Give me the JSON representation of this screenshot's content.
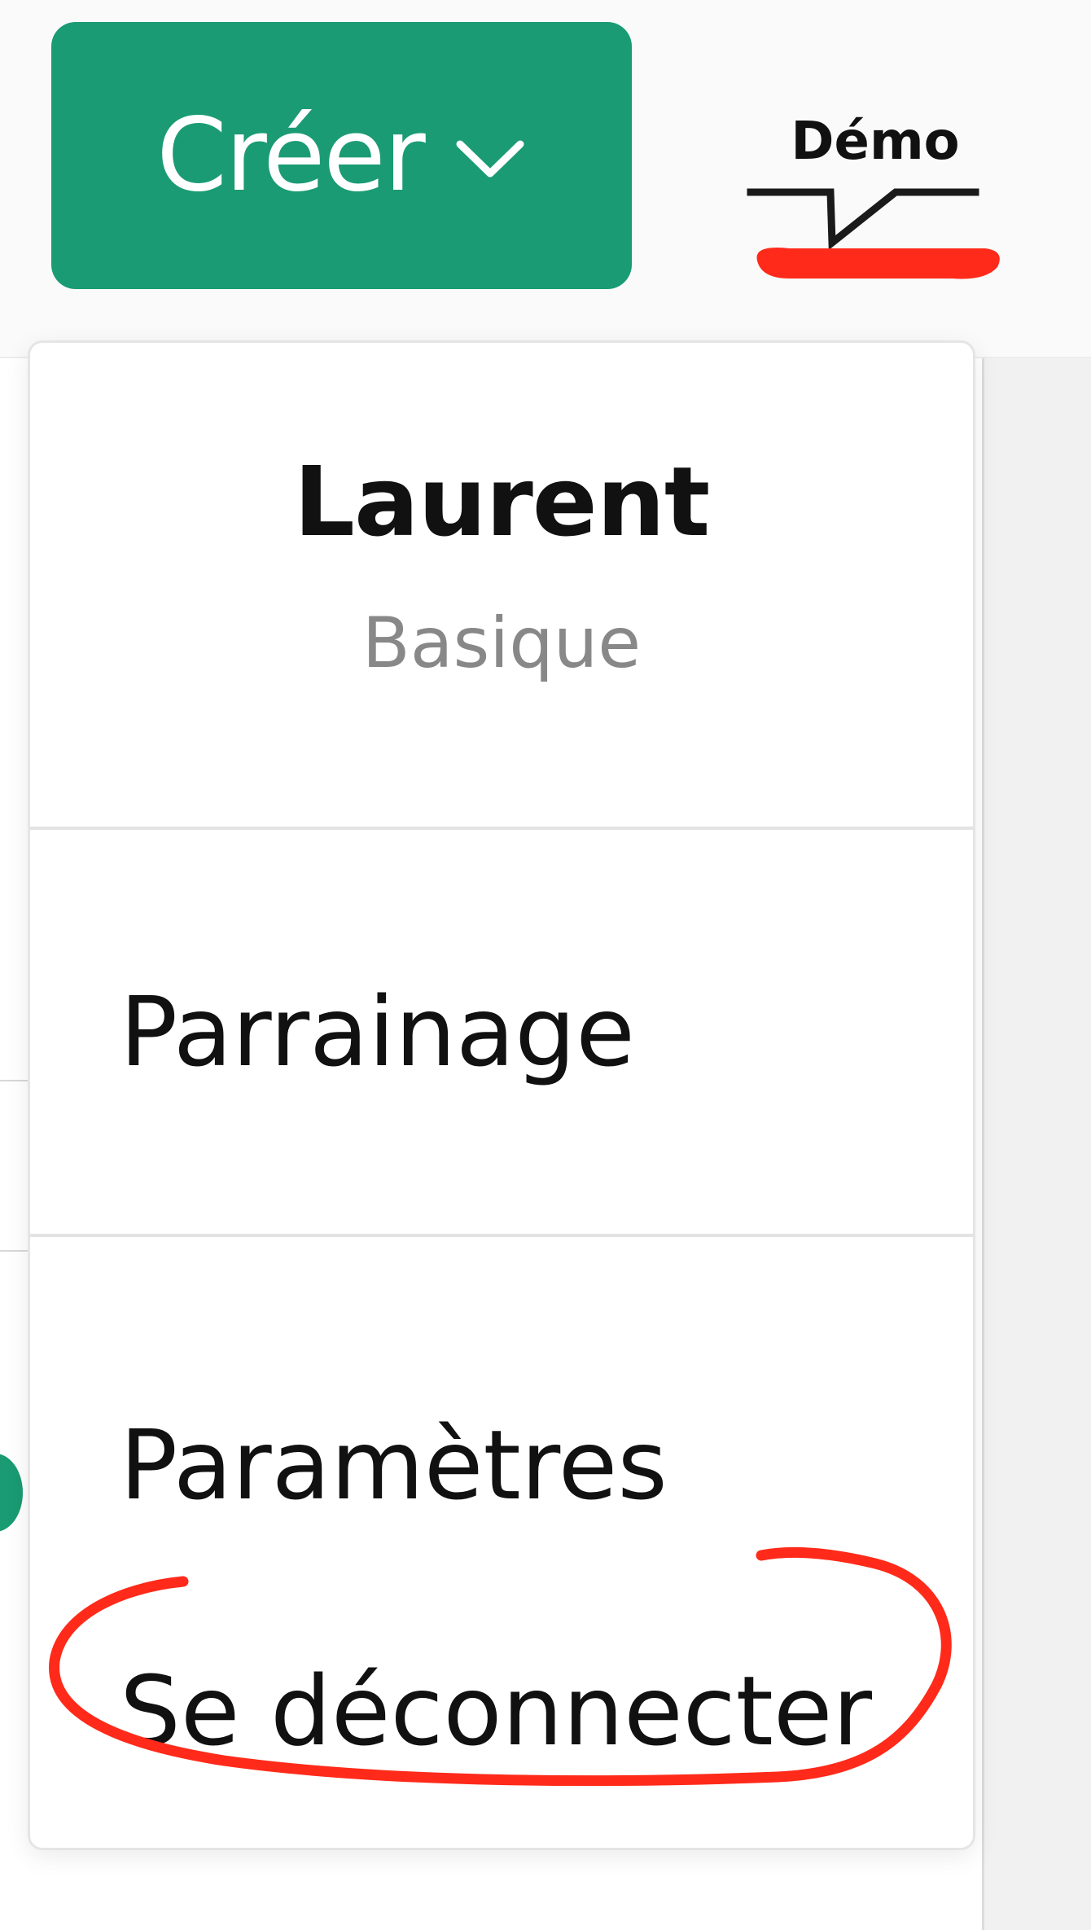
{
  "header": {
    "create_button": {
      "label": "Créer",
      "chevron_icon": "chevron-down-icon",
      "background_color": "#1a9b74"
    },
    "logo": {
      "text": "Démo"
    }
  },
  "user_menu": {
    "user_name": "Laurent",
    "plan": "Basique",
    "items": [
      {
        "label": "Parrainage"
      },
      {
        "label": "Paramètres"
      },
      {
        "label": "Se déconnecter"
      }
    ]
  },
  "annotation": {
    "color": "#ff2a1a"
  }
}
